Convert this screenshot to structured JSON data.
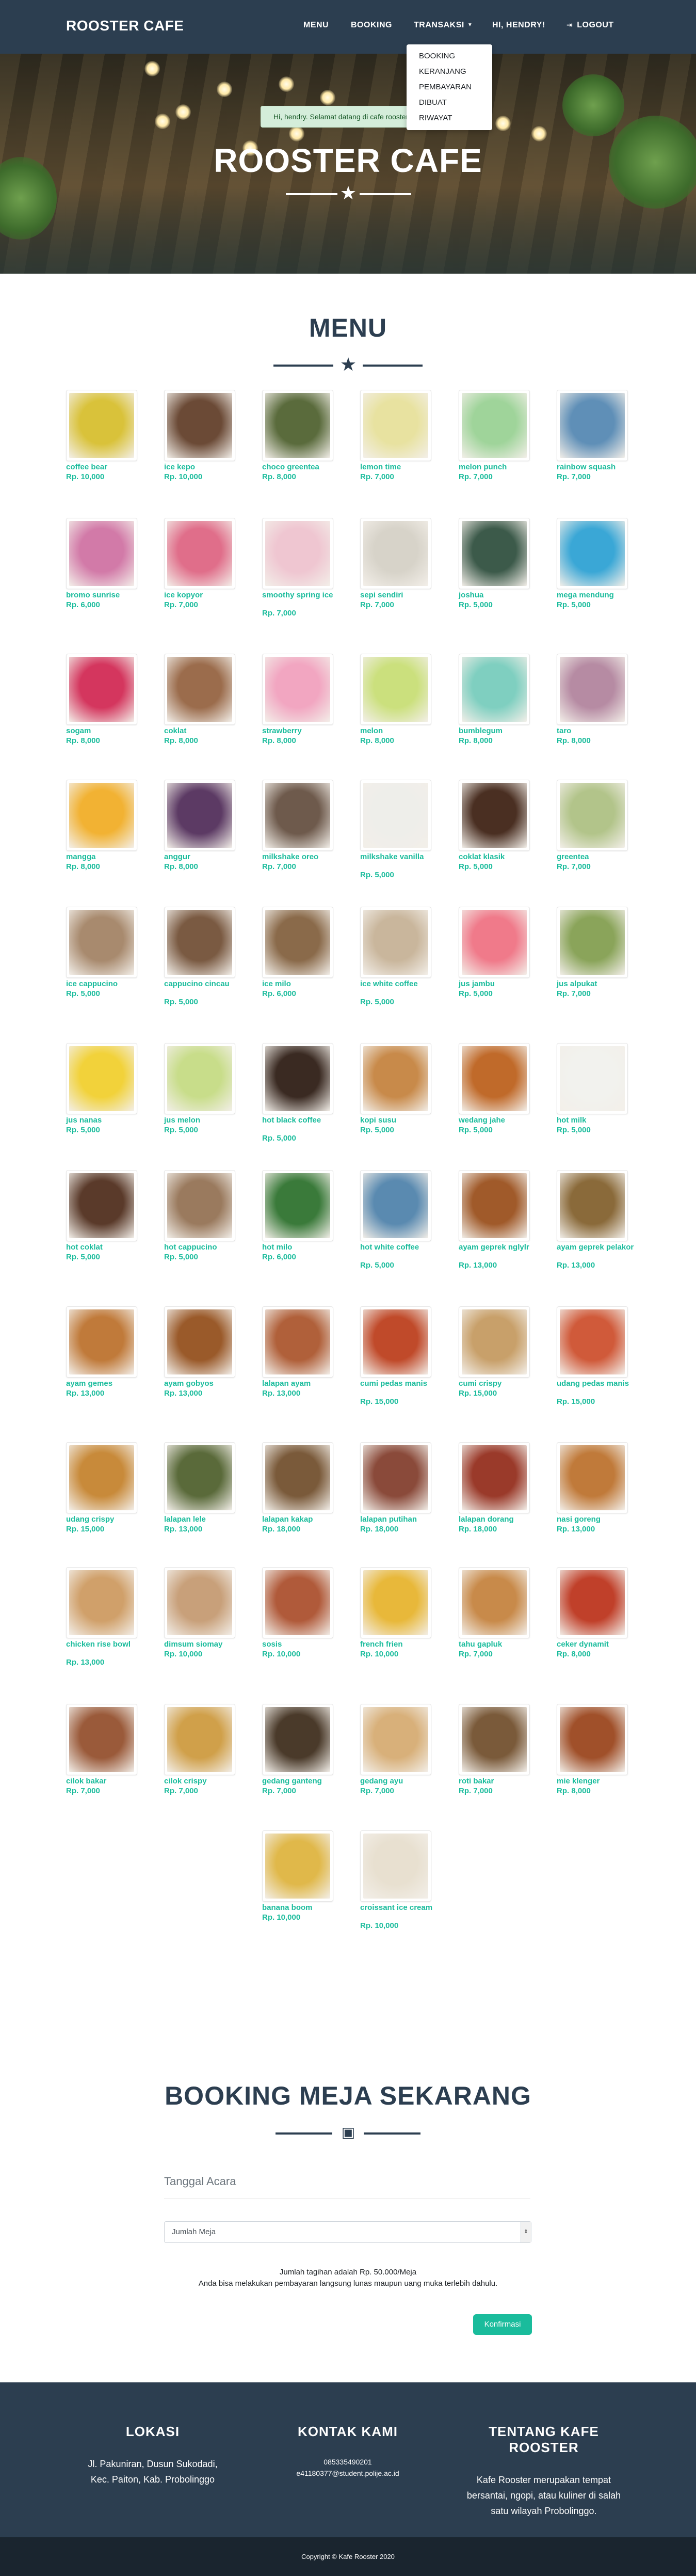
{
  "nav": {
    "brand": "ROOSTER CAFE",
    "menu": "MENU",
    "booking": "BOOKING",
    "transaksi": "TRANSAKSI",
    "user": "HI, HENDRY!",
    "logout": "LOGOUT",
    "dropdown": [
      "BOOKING",
      "KERANJANG",
      "PEMBAYARAN",
      "DIBUAT",
      "RIWAYAT"
    ]
  },
  "header": {
    "flash": "Hi, hendry. Selamat datang di cafe rooster",
    "title": "ROOSTER CAFE"
  },
  "menu": {
    "title": "MENU",
    "items": [
      {
        "name": "coffee bear",
        "price": "Rp. 10,000",
        "color": "#d9c23a"
      },
      {
        "name": "ice kepo",
        "price": "Rp. 10,000",
        "color": "#6b4a36"
      },
      {
        "name": "choco greentea",
        "price": "Rp. 8,000",
        "color": "#5a6b3c"
      },
      {
        "name": "lemon time",
        "price": "Rp. 7,000",
        "color": "#e8e2a0"
      },
      {
        "name": "melon punch",
        "price": "Rp. 7,000",
        "color": "#9fd49a"
      },
      {
        "name": "rainbow squash",
        "price": "Rp. 7,000",
        "color": "#5f8fb7"
      },
      {
        "name": "bromo sunrise",
        "price": "Rp. 6,000",
        "color": "#d27aa8"
      },
      {
        "name": "ice kopyor",
        "price": "Rp. 7,000",
        "color": "#e06e8a"
      },
      {
        "name": "smoothy spring ice",
        "price": "Rp. 7,000",
        "color": "#efc6d1"
      },
      {
        "name": "sepi sendiri",
        "price": "Rp. 7,000",
        "color": "#d7d3c9"
      },
      {
        "name": "joshua",
        "price": "Rp. 5,000",
        "color": "#3c5a4a"
      },
      {
        "name": "mega mendung",
        "price": "Rp. 5,000",
        "color": "#3aa7d6"
      },
      {
        "name": "sogam",
        "price": "Rp. 8,000",
        "color": "#d4365e"
      },
      {
        "name": "coklat",
        "price": "Rp. 8,000",
        "color": "#9b6c4c"
      },
      {
        "name": "strawberry",
        "price": "Rp. 8,000",
        "color": "#f2a6c1"
      },
      {
        "name": "melon",
        "price": "Rp. 8,000",
        "color": "#cbe07d"
      },
      {
        "name": "bumblegum",
        "price": "Rp. 8,000",
        "color": "#7fcfc0"
      },
      {
        "name": "taro",
        "price": "Rp. 8,000",
        "color": "#b68ba3"
      },
      {
        "name": "mangga",
        "price": "Rp. 8,000",
        "color": "#f2b233"
      },
      {
        "name": "anggur",
        "price": "Rp. 8,000",
        "color": "#5c3a64"
      },
      {
        "name": "milkshake oreo",
        "price": "Rp. 7,000",
        "color": "#6e5a4c"
      },
      {
        "name": "milkshake vanilla",
        "price": "Rp. 5,000",
        "color": "#eeeeea"
      },
      {
        "name": "coklat klasik",
        "price": "Rp. 5,000",
        "color": "#4a2f22"
      },
      {
        "name": "greentea",
        "price": "Rp. 7,000",
        "color": "#b2c48a"
      },
      {
        "name": "ice cappucino",
        "price": "Rp. 5,000",
        "color": "#a88a6e"
      },
      {
        "name": "cappucino cincau",
        "price": "Rp. 5,000",
        "color": "#7a5a42"
      },
      {
        "name": "ice milo",
        "price": "Rp. 6,000",
        "color": "#8a6a4a"
      },
      {
        "name": "ice white coffee",
        "price": "Rp. 5,000",
        "color": "#c9b69c"
      },
      {
        "name": "jus jambu",
        "price": "Rp. 5,000",
        "color": "#f07a8a"
      },
      {
        "name": "jus alpukat",
        "price": "Rp. 7,000",
        "color": "#8aa45a"
      },
      {
        "name": "jus nanas",
        "price": "Rp. 5,000",
        "color": "#f2d23a"
      },
      {
        "name": "jus melon",
        "price": "Rp. 5,000",
        "color": "#c8dd8a"
      },
      {
        "name": "hot black coffee",
        "price": "Rp. 5,000",
        "color": "#3a2a22"
      },
      {
        "name": "kopi susu",
        "price": "Rp. 5,000",
        "color": "#c88a4a"
      },
      {
        "name": "wedang jahe",
        "price": "Rp. 5,000",
        "color": "#c06a2a"
      },
      {
        "name": "hot milk",
        "price": "Rp. 5,000",
        "color": "#f2f2ee"
      },
      {
        "name": "hot coklat",
        "price": "Rp. 5,000",
        "color": "#5a3a2a"
      },
      {
        "name": "hot cappucino",
        "price": "Rp. 5,000",
        "color": "#9a7a5e"
      },
      {
        "name": "hot milo",
        "price": "Rp. 6,000",
        "color": "#3a7a3a"
      },
      {
        "name": "hot white coffee",
        "price": "Rp. 5,000",
        "color": "#5a8ab0"
      },
      {
        "name": "ayam geprek nglylr",
        "price": "Rp. 13,000",
        "color": "#a05a2a"
      },
      {
        "name": "ayam geprek pelakor",
        "price": "Rp. 13,000",
        "color": "#8a6a3a"
      },
      {
        "name": "ayam gemes",
        "price": "Rp. 13,000",
        "color": "#c07a3a"
      },
      {
        "name": "ayam gobyos",
        "price": "Rp. 13,000",
        "color": "#9a5a2a"
      },
      {
        "name": "lalapan ayam",
        "price": "Rp. 13,000",
        "color": "#b0603a"
      },
      {
        "name": "cumi pedas manis",
        "price": "Rp. 15,000",
        "color": "#c04a2a"
      },
      {
        "name": "cumi crispy",
        "price": "Rp. 15,000",
        "color": "#c8a06a"
      },
      {
        "name": "udang pedas manis",
        "price": "Rp. 15,000",
        "color": "#d05a3a"
      },
      {
        "name": "udang crispy",
        "price": "Rp. 15,000",
        "color": "#c88a3a"
      },
      {
        "name": "lalapan lele",
        "price": "Rp. 13,000",
        "color": "#5a6a3a"
      },
      {
        "name": "lalapan kakap",
        "price": "Rp. 18,000",
        "color": "#7a5a3a"
      },
      {
        "name": "lalapan putihan",
        "price": "Rp. 18,000",
        "color": "#8a4a3a"
      },
      {
        "name": "lalapan dorang",
        "price": "Rp. 18,000",
        "color": "#9a3a2a"
      },
      {
        "name": "nasi goreng",
        "price": "Rp. 13,000",
        "color": "#c07a3a"
      },
      {
        "name": "chicken rise bowl",
        "price": "Rp. 13,000",
        "color": "#d0a06a"
      },
      {
        "name": "dimsum siomay",
        "price": "Rp. 10,000",
        "color": "#c8a07a"
      },
      {
        "name": "sosis",
        "price": "Rp. 10,000",
        "color": "#b05a3a"
      },
      {
        "name": "french frien",
        "price": "Rp. 10,000",
        "color": "#e8b83a"
      },
      {
        "name": "tahu gapluk",
        "price": "Rp. 7,000",
        "color": "#c88a4a"
      },
      {
        "name": "ceker dynamit",
        "price": "Rp. 8,000",
        "color": "#c0402a"
      },
      {
        "name": "cilok bakar",
        "price": "Rp. 7,000",
        "color": "#9a5a3a"
      },
      {
        "name": "cilok crispy",
        "price": "Rp. 7,000",
        "color": "#d0a04a"
      },
      {
        "name": "gedang ganteng",
        "price": "Rp. 7,000",
        "color": "#4a3a2a"
      },
      {
        "name": "gedang ayu",
        "price": "Rp. 7,000",
        "color": "#d8b07a"
      },
      {
        "name": "roti bakar",
        "price": "Rp. 7,000",
        "color": "#7a5a3a"
      },
      {
        "name": "mie klenger",
        "price": "Rp. 8,000",
        "color": "#a0502a"
      },
      {
        "name": "banana boom",
        "price": "Rp. 10,000",
        "color": "#e0b84a"
      },
      {
        "name": "croissant ice cream",
        "price": "Rp. 10,000",
        "color": "#e8e0d0"
      }
    ]
  },
  "booking": {
    "title": "BOOKING MEJA SEKARANG",
    "tanggal_label": "Tanggal Acara",
    "select_value": "Jumlah Meja",
    "note_1": "Jumlah tagihan adalah Rp. 50.000/Meja",
    "note_2": "Anda bisa melakukan pembayaran langsung lunas maupun uang muka terlebih dahulu.",
    "confirm": "Konfirmasi"
  },
  "footer": {
    "lokasi_title": "LOKASI",
    "lokasi_1": "Jl. Pakuniran, Dusun Sukodadi,",
    "lokasi_2": "Kec. Paiton, Kab. Probolinggo",
    "kontak_title": "KONTAK KAMI",
    "kontak_1": "085335490201",
    "kontak_2": "e41180377@student.polije.ac.id",
    "tentang_title": "TENTANG KAFE ROOSTER",
    "tentang_1": "Kafe Rooster merupakan tempat",
    "tentang_2": "bersantai, ngopi, atau kuliner di salah",
    "tentang_3": "satu wilayah Probolinggo.",
    "copyright": "Copyright © Kafe Rooster 2020"
  },
  "colors": {
    "primary": "#2c3e50",
    "accent": "#1abc9c"
  }
}
